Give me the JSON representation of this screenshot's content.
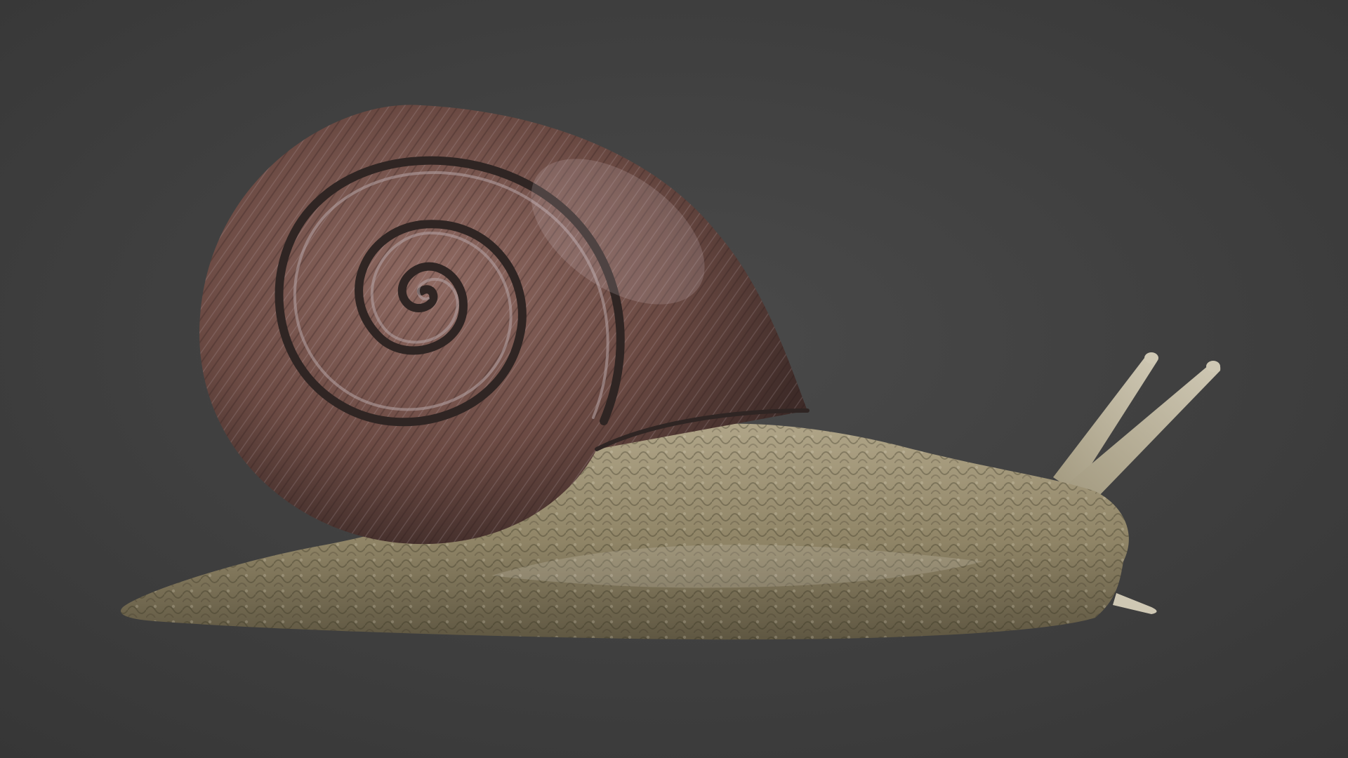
{
  "scene": {
    "subject": "snail-render",
    "colors": {
      "background_center": "#4a4a4a",
      "background_edge": "#363636",
      "shell_light": "#8f6a62",
      "shell_mid": "#6b4a43",
      "shell_dark": "#3e2b28",
      "shell_highlight": "#b7a5a8",
      "shell_groove": "#2f2523",
      "body_light": "#b0a588",
      "body_mid": "#8f8466",
      "body_dark": "#5f5742",
      "tentacle": "#a39a80",
      "tentacle_tip": "#cfc8b4"
    }
  }
}
